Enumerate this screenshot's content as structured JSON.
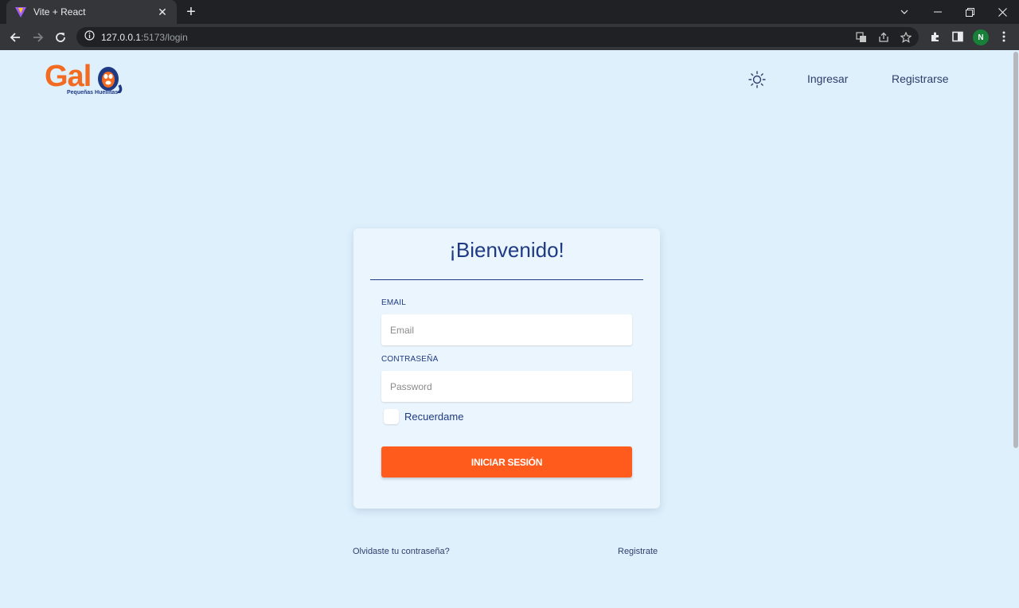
{
  "browser": {
    "tab_title": "Vite + React",
    "url_host": "127.0.0.1",
    "url_path": ":5173/login",
    "profile_initial": "N"
  },
  "header": {
    "logo_text": "Gal",
    "logo_tagline": "Pequeñas Huellitas",
    "nav_links": [
      "Ingresar",
      "Registrarse"
    ]
  },
  "login": {
    "title": "¡Bienvenido!",
    "email_label": "EMAIL",
    "email_placeholder": "Email",
    "password_label": "CONTRASEÑA",
    "password_placeholder": "Password",
    "remember_label": "Recuerdame",
    "submit_label": "INICIAR SESIÓN"
  },
  "footer": {
    "forgot_password": "Olvidaste tu contraseña?",
    "register": "Registrate"
  },
  "colors": {
    "page_bg": "#def0fc",
    "brand_orange": "#f26b21",
    "brand_blue": "#1f3a84",
    "button": "#fe5b1c"
  }
}
